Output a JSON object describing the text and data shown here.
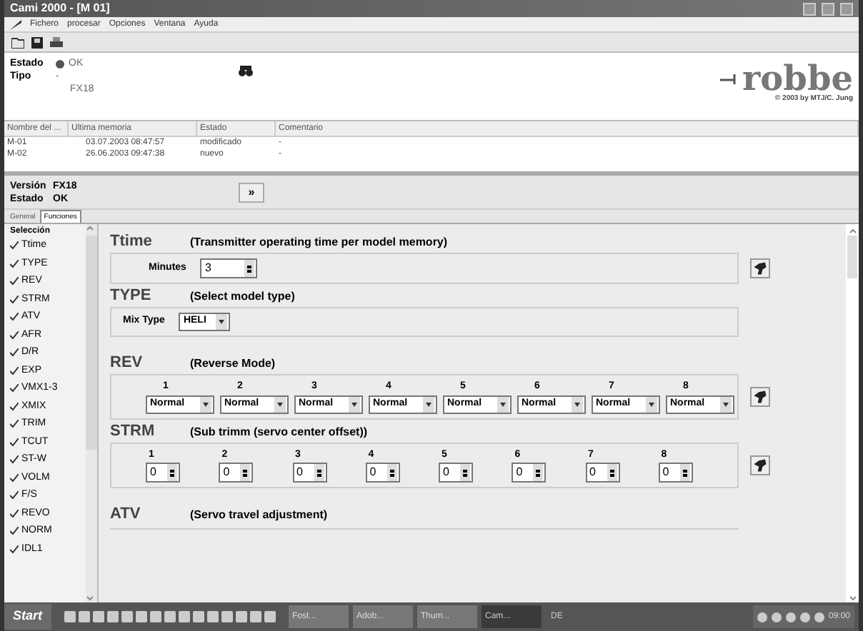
{
  "window": {
    "title": "Cami 2000 - [M 01]"
  },
  "menu": [
    "Fichero",
    "procesar",
    "Opciones",
    "Ventana",
    "Ayuda"
  ],
  "info": {
    "estado_label": "Estado",
    "estado_value": "OK",
    "tipo_label": "Tipo",
    "tipo_value": "-",
    "tipo_sub": "FX18",
    "logo": "robbe",
    "copyright": "© 2003 by MTJ/C. Jung"
  },
  "table": {
    "columns": [
      "Nombre del ...",
      "Ultima memoria",
      "Estado",
      "Comentario"
    ],
    "rows": [
      [
        "M-01",
        "03.07.2003 08:47:57",
        "modificado",
        "-"
      ],
      [
        "M-02",
        "26.06.2003 09:47:38",
        "nuevo",
        "-"
      ]
    ]
  },
  "version": {
    "version_label": "Versión",
    "version_value": "FX18",
    "estado_label": "Estado",
    "estado_value": "OK",
    "button": "»"
  },
  "tabs": [
    {
      "label": "General",
      "selected": false
    },
    {
      "label": "Funciones",
      "selected": true
    }
  ],
  "selection": {
    "title": "Selección",
    "items": [
      {
        "label": "Ttime",
        "checked": true
      },
      {
        "label": "TYPE",
        "checked": true
      },
      {
        "label": "REV",
        "checked": true
      },
      {
        "label": "STRM",
        "checked": true
      },
      {
        "label": "ATV",
        "checked": true
      },
      {
        "label": "AFR",
        "checked": true
      },
      {
        "label": "D/R",
        "checked": true
      },
      {
        "label": "EXP",
        "checked": true
      },
      {
        "label": "VMX1-3",
        "checked": true
      },
      {
        "label": "XMIX",
        "checked": true
      },
      {
        "label": "TRIM",
        "checked": true
      },
      {
        "label": "TCUT",
        "checked": true
      },
      {
        "label": "ST-W",
        "checked": true
      },
      {
        "label": "VOLM",
        "checked": true
      },
      {
        "label": "F/S",
        "checked": true
      },
      {
        "label": "REVO",
        "checked": true
      },
      {
        "label": "NORM",
        "checked": true
      },
      {
        "label": "IDL1",
        "checked": true
      }
    ]
  },
  "sections": [
    {
      "kind": "spin",
      "name": "Ttime",
      "desc": "(Transmitter operating time per model memory)",
      "label": "Minutes",
      "value": "3",
      "apply": true
    },
    {
      "kind": "select",
      "name": "TYPE",
      "desc": "(Select model type)",
      "label": "Mix Type",
      "value": "HELI",
      "apply": false
    },
    {
      "kind": "channels-select",
      "name": "REV",
      "desc": "(Reverse Mode)",
      "channels": [
        {
          "label": "1",
          "value": "Normal"
        },
        {
          "label": "2",
          "value": "Normal"
        },
        {
          "label": "3",
          "value": "Normal"
        },
        {
          "label": "4",
          "value": "Normal"
        },
        {
          "label": "5",
          "value": "Normal"
        },
        {
          "label": "6",
          "value": "Normal"
        },
        {
          "label": "7",
          "value": "Normal"
        },
        {
          "label": "8",
          "value": "Normal"
        }
      ],
      "apply": true
    },
    {
      "kind": "channels-spin",
      "name": "STRM",
      "desc": "(Sub trimm (servo center offset))",
      "channels": [
        {
          "label": "1",
          "value": "0"
        },
        {
          "label": "2",
          "value": "0"
        },
        {
          "label": "3",
          "value": "0"
        },
        {
          "label": "4",
          "value": "0"
        },
        {
          "label": "5",
          "value": "0"
        },
        {
          "label": "6",
          "value": "0"
        },
        {
          "label": "7",
          "value": "0"
        },
        {
          "label": "8",
          "value": "0"
        }
      ],
      "apply": true
    },
    {
      "kind": "header",
      "name": "ATV",
      "desc": "(Servo travel adjustment)",
      "apply": false
    }
  ],
  "taskbar": {
    "start": "Start",
    "tasks": [
      {
        "label": "Fost...",
        "selected": false
      },
      {
        "label": "Adob...",
        "selected": false
      },
      {
        "label": "Thum...",
        "selected": false
      },
      {
        "label": "Cam...",
        "selected": true
      }
    ],
    "language": "DE",
    "clock": "09:00"
  }
}
